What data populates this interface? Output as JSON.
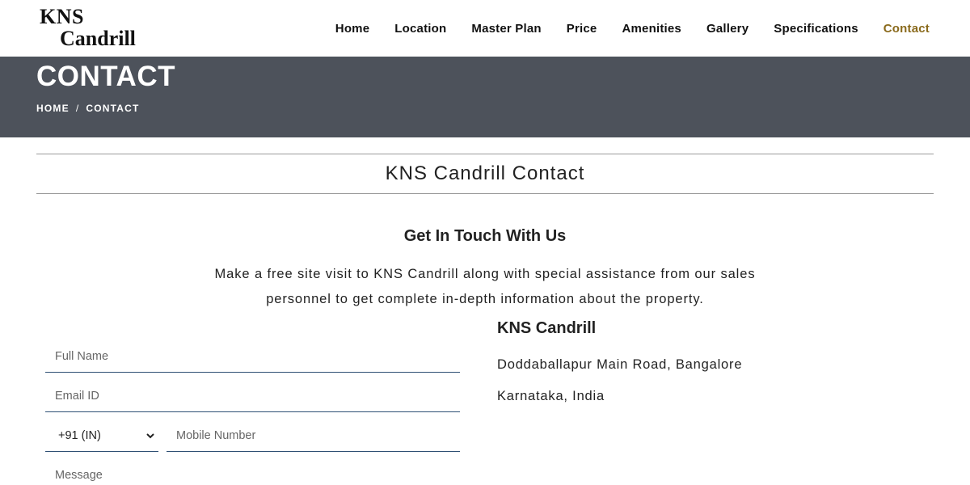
{
  "brand": {
    "line1": "KNS",
    "line2": "Candrill"
  },
  "nav": {
    "items": [
      "Home",
      "Location",
      "Master Plan",
      "Price",
      "Amenities",
      "Gallery",
      "Specifications",
      "Contact"
    ],
    "active": "Contact",
    "active_color": "#8a6a1c"
  },
  "banner": {
    "title": "CONTACT",
    "breadcrumb": [
      "HOME",
      "CONTACT"
    ],
    "separator": "/",
    "bg_color": "#4d525b"
  },
  "section": {
    "heading": "KNS Candrill Contact"
  },
  "touch": {
    "heading": "Get In Touch With Us",
    "intro": "Make a free site visit to KNS Candrill along with special assistance from our sales personnel to get complete in-depth information about the property."
  },
  "form": {
    "name_placeholder": "Full Name",
    "email_placeholder": "Email ID",
    "country_code": "+91 (IN)",
    "mobile_placeholder": "Mobile Number",
    "message_placeholder": "Message",
    "underline_color": "#2d4f73"
  },
  "address": {
    "title": "KNS Candrill",
    "line1": "Doddaballapur Main Road, Bangalore",
    "line2": "Karnataka, India"
  }
}
